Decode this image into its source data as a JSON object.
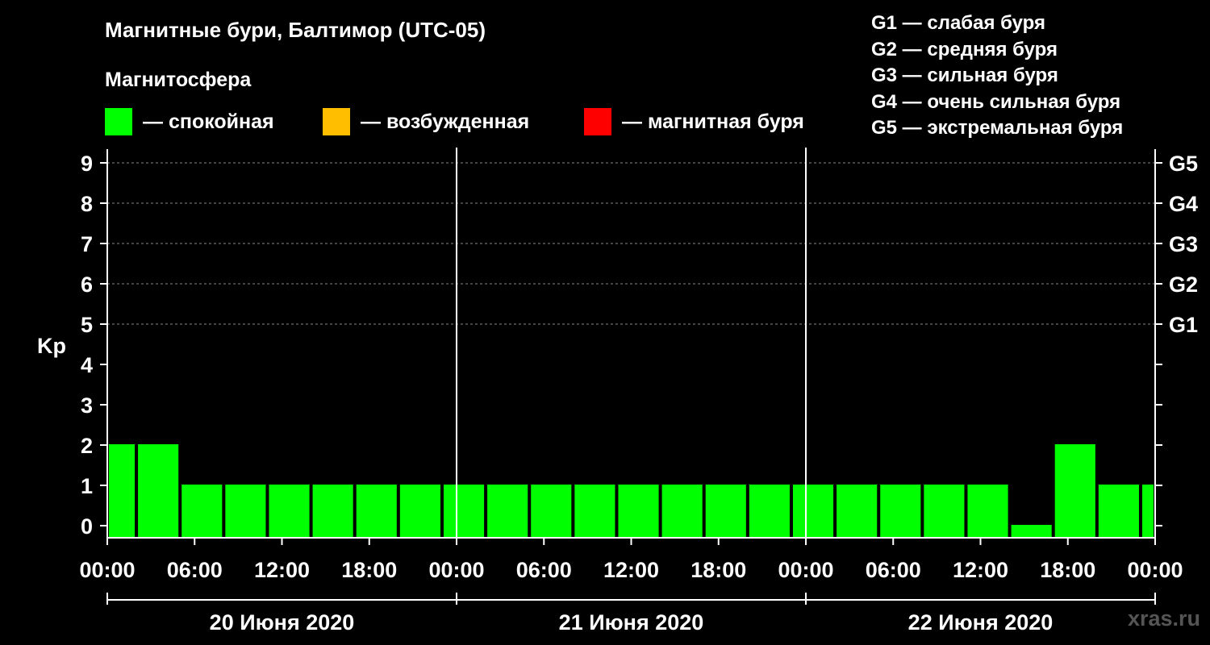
{
  "header": {
    "title": "Магнитные бури, Балтимор (UTC-05)",
    "subtitle": "Магнитосфера"
  },
  "legend": [
    {
      "label": "— спокойная",
      "color": "#00ff00"
    },
    {
      "label": "— возбужденная",
      "color": "#ffbf00"
    },
    {
      "label": "— магнитная буря",
      "color": "#ff0000"
    }
  ],
  "storm_levels": [
    "G1 — слабая буря",
    "G2 — средняя буря",
    "G3 — сильная буря",
    "G4 — очень сильная буря",
    "G5 — экстремальная буря"
  ],
  "watermark": "xras.ru",
  "chart_data": {
    "type": "bar",
    "ylabel": "Kp",
    "ylim": [
      0,
      9
    ],
    "yticks": [
      "0",
      "1",
      "2",
      "3",
      "4",
      "5",
      "6",
      "7",
      "8",
      "9"
    ],
    "right_ticks": [
      {
        "kp": 5,
        "label": "G1"
      },
      {
        "kp": 6,
        "label": "G2"
      },
      {
        "kp": 7,
        "label": "G3"
      },
      {
        "kp": 8,
        "label": "G4"
      },
      {
        "kp": 9,
        "label": "G5"
      }
    ],
    "grid": "dashed horizontal lines at Kp 5–9",
    "x_tick_labels": [
      "00:00",
      "06:00",
      "12:00",
      "18:00",
      "00:00",
      "06:00",
      "12:00",
      "18:00",
      "00:00",
      "06:00",
      "12:00",
      "18:00",
      "00:00"
    ],
    "days": [
      "20 Июня 2020",
      "21 Июня 2020",
      "22 Июня 2020"
    ],
    "x_start_hour": 0,
    "x_end_hour": 72,
    "bar_color": "#00ff00",
    "bars": [
      {
        "start": 0,
        "end": 2,
        "kp": 2
      },
      {
        "start": 2,
        "end": 5,
        "kp": 2
      },
      {
        "start": 5,
        "end": 8,
        "kp": 1
      },
      {
        "start": 8,
        "end": 11,
        "kp": 1
      },
      {
        "start": 11,
        "end": 14,
        "kp": 1
      },
      {
        "start": 14,
        "end": 17,
        "kp": 1
      },
      {
        "start": 17,
        "end": 20,
        "kp": 1
      },
      {
        "start": 20,
        "end": 23,
        "kp": 1
      },
      {
        "start": 23,
        "end": 26,
        "kp": 1
      },
      {
        "start": 26,
        "end": 29,
        "kp": 1
      },
      {
        "start": 29,
        "end": 32,
        "kp": 1
      },
      {
        "start": 32,
        "end": 35,
        "kp": 1
      },
      {
        "start": 35,
        "end": 38,
        "kp": 1
      },
      {
        "start": 38,
        "end": 41,
        "kp": 1
      },
      {
        "start": 41,
        "end": 44,
        "kp": 1
      },
      {
        "start": 44,
        "end": 47,
        "kp": 1
      },
      {
        "start": 47,
        "end": 50,
        "kp": 1
      },
      {
        "start": 50,
        "end": 53,
        "kp": 1
      },
      {
        "start": 53,
        "end": 56,
        "kp": 1
      },
      {
        "start": 56,
        "end": 59,
        "kp": 1
      },
      {
        "start": 59,
        "end": 62,
        "kp": 1
      },
      {
        "start": 62,
        "end": 65,
        "kp": 0
      },
      {
        "start": 65,
        "end": 68,
        "kp": 2
      },
      {
        "start": 68,
        "end": 71,
        "kp": 1
      },
      {
        "start": 71,
        "end": 72,
        "kp": 1
      }
    ]
  }
}
